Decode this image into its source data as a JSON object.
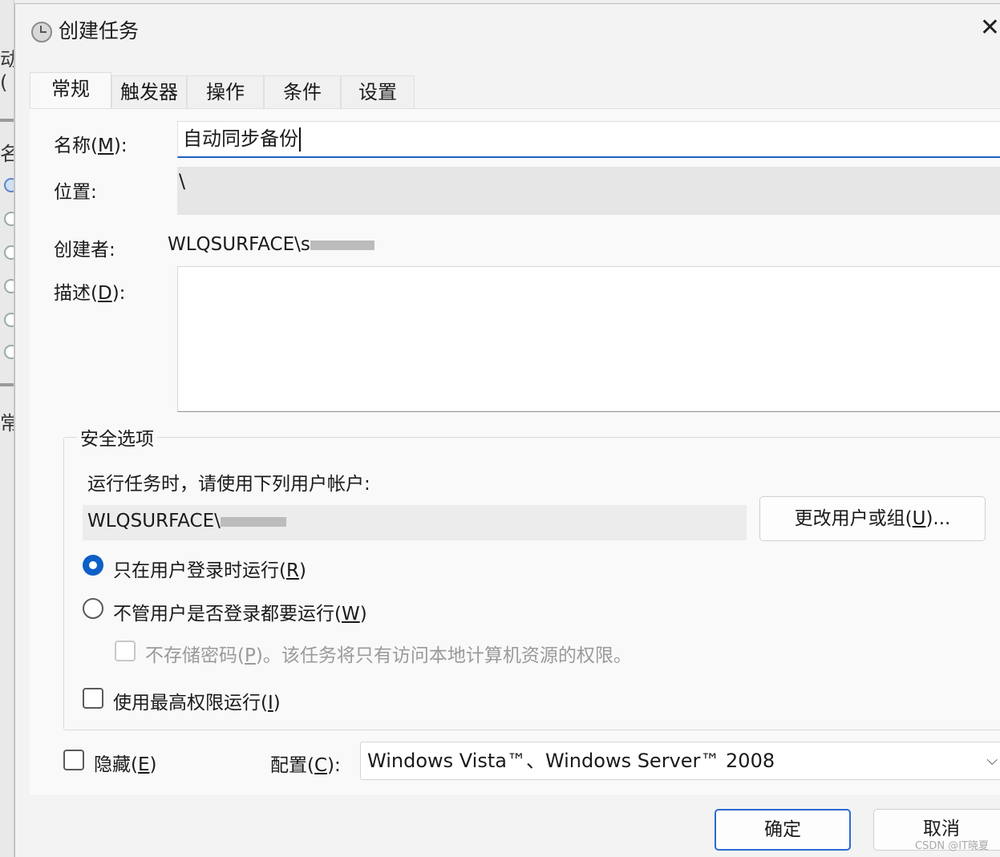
{
  "window": {
    "title": "创建任务",
    "close_glyph": "✕"
  },
  "background_app": {
    "fragments": [
      "动(",
      "名",
      "常"
    ]
  },
  "tabs": [
    {
      "label": "常规",
      "active": true
    },
    {
      "label": "触发器"
    },
    {
      "label": "操作"
    },
    {
      "label": "条件"
    },
    {
      "label": "设置"
    }
  ],
  "general": {
    "name_label": "名称(",
    "name_key": "M",
    "name_label_end": "):",
    "name_value": "自动同步备份",
    "location_label": "位置:",
    "location_value": "\\",
    "author_label": "创建者:",
    "author_value": "WLQSURFACE\\s",
    "description_label": "描述(",
    "description_key": "D",
    "description_label_end": "):",
    "description_value": ""
  },
  "security": {
    "group_title": "安全选项",
    "run_as_prompt": "运行任务时，请使用下列用户帐户:",
    "user_account": "WLQSURFACE\\",
    "change_user_button_pre": "更改用户或组(",
    "change_user_button_key": "U",
    "change_user_button_post": ")...",
    "option_logged_on_pre": "只在用户登录时运行(",
    "option_logged_on_key": "R",
    "option_logged_on_post": ")",
    "option_logged_on_selected": true,
    "option_any_pre": "不管用户是否登录都要运行(",
    "option_any_key": "W",
    "option_any_post": ")",
    "option_any_selected": false,
    "no_store_password_pre": "不存储密码(",
    "no_store_password_key": "P",
    "no_store_password_post": ")。该任务将只有访问本地计算机资源的权限。",
    "no_store_password_checked": false,
    "highest_privileges_pre": "使用最高权限运行(",
    "highest_privileges_key": "I",
    "highest_privileges_post": ")",
    "highest_privileges_checked": false
  },
  "bottom": {
    "hidden_pre": "隐藏(",
    "hidden_key": "E",
    "hidden_post": ")",
    "hidden_checked": false,
    "config_label_pre": "配置(",
    "config_label_key": "C",
    "config_label_post": "):",
    "config_value": "Windows Vista™、Windows Server™ 2008"
  },
  "buttons": {
    "ok": "确定",
    "cancel": "取消"
  },
  "watermark": "CSDN @IT晓夏",
  "colors": {
    "accent": "#0e5fc7",
    "focus_underline": "#1f5fbf"
  }
}
